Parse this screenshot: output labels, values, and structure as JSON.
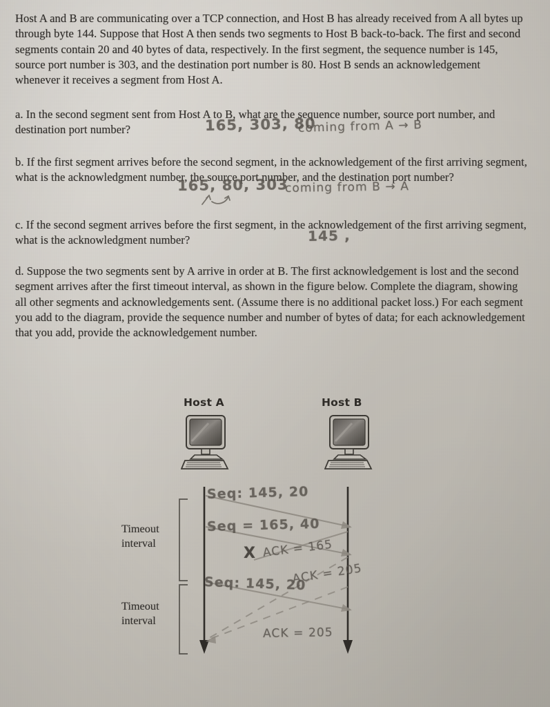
{
  "document": {
    "type": "scanned-textbook-page-with-handwriting",
    "paper_color": "#c9c5be",
    "ink_color": "#33302d",
    "pencil_color": "#55504a"
  },
  "problem": {
    "intro": "Host A and B are communicating over a TCP connection, and Host B has already received from A all bytes up through byte 144. Suppose that Host A then sends two segments to Host B back-to-back. The first and second segments contain 20 and 40 bytes of data, respectively. In the first segment, the sequence number is 145, source port number is 303, and the destination port number is 80. Host B sends an acknowledgement whenever it receives a segment from Host A.",
    "parts": [
      {
        "id": "a",
        "text": "a. In the second segment sent from Host A to B, what are the sequence number, source port number, and destination port number?",
        "answer": "165, 303, 80",
        "annotation": "coming from A → B"
      },
      {
        "id": "b",
        "text": "b. If the first segment arrives before the second segment, in the acknowledgement of the first arriving segment, what is the acknowledgment number, the source port number, and the destination port number?",
        "answer": "165, 80, 303",
        "annotation": "coming from B → A"
      },
      {
        "id": "c",
        "text": "c. If the second segment arrives before the first segment, in the acknowledgement of the first arriving segment, what is the acknowledgment number?",
        "answer": "145 ,",
        "annotation": ""
      },
      {
        "id": "d",
        "text": "d. Suppose the two segments sent by A arrive in order at B. The first acknowledgement is lost and the second segment arrives after the first timeout interval, as shown in the figure below. Complete the diagram, showing all other segments and acknowledgements sent. (Assume there is no additional packet loss.) For each segment you add to the diagram, provide the sequence number and number of bytes of data; for each acknowledgement that you add, provide the acknowledgement number.",
        "answer": "",
        "annotation": ""
      }
    ]
  },
  "figure": {
    "host_a_label": "Host A",
    "host_b_label": "Host B",
    "timeout_label_line1": "Timeout",
    "timeout_label_line2": "interval",
    "timeout_intervals": 2,
    "messages": [
      {
        "id": "seg1",
        "label": "Seq: 145, 20",
        "direction": "a-to-b",
        "style": "solid",
        "lost": false
      },
      {
        "id": "seg2",
        "label": "Seq = 165, 40",
        "direction": "a-to-b",
        "style": "solid",
        "lost": false
      },
      {
        "id": "ack1",
        "label": "ACK = 165",
        "direction": "b-to-a",
        "style": "solid",
        "lost": true
      },
      {
        "id": "ack2",
        "label": "ACK = 205",
        "direction": "b-to-a",
        "style": "dashed",
        "lost": false
      },
      {
        "id": "seg3",
        "label": "Seq: 145, 20",
        "direction": "a-to-b",
        "style": "solid",
        "lost": false
      },
      {
        "id": "ack3",
        "label": "ACK = 205",
        "direction": "b-to-a",
        "style": "dashed",
        "lost": false
      }
    ],
    "loss_marker": "X"
  }
}
